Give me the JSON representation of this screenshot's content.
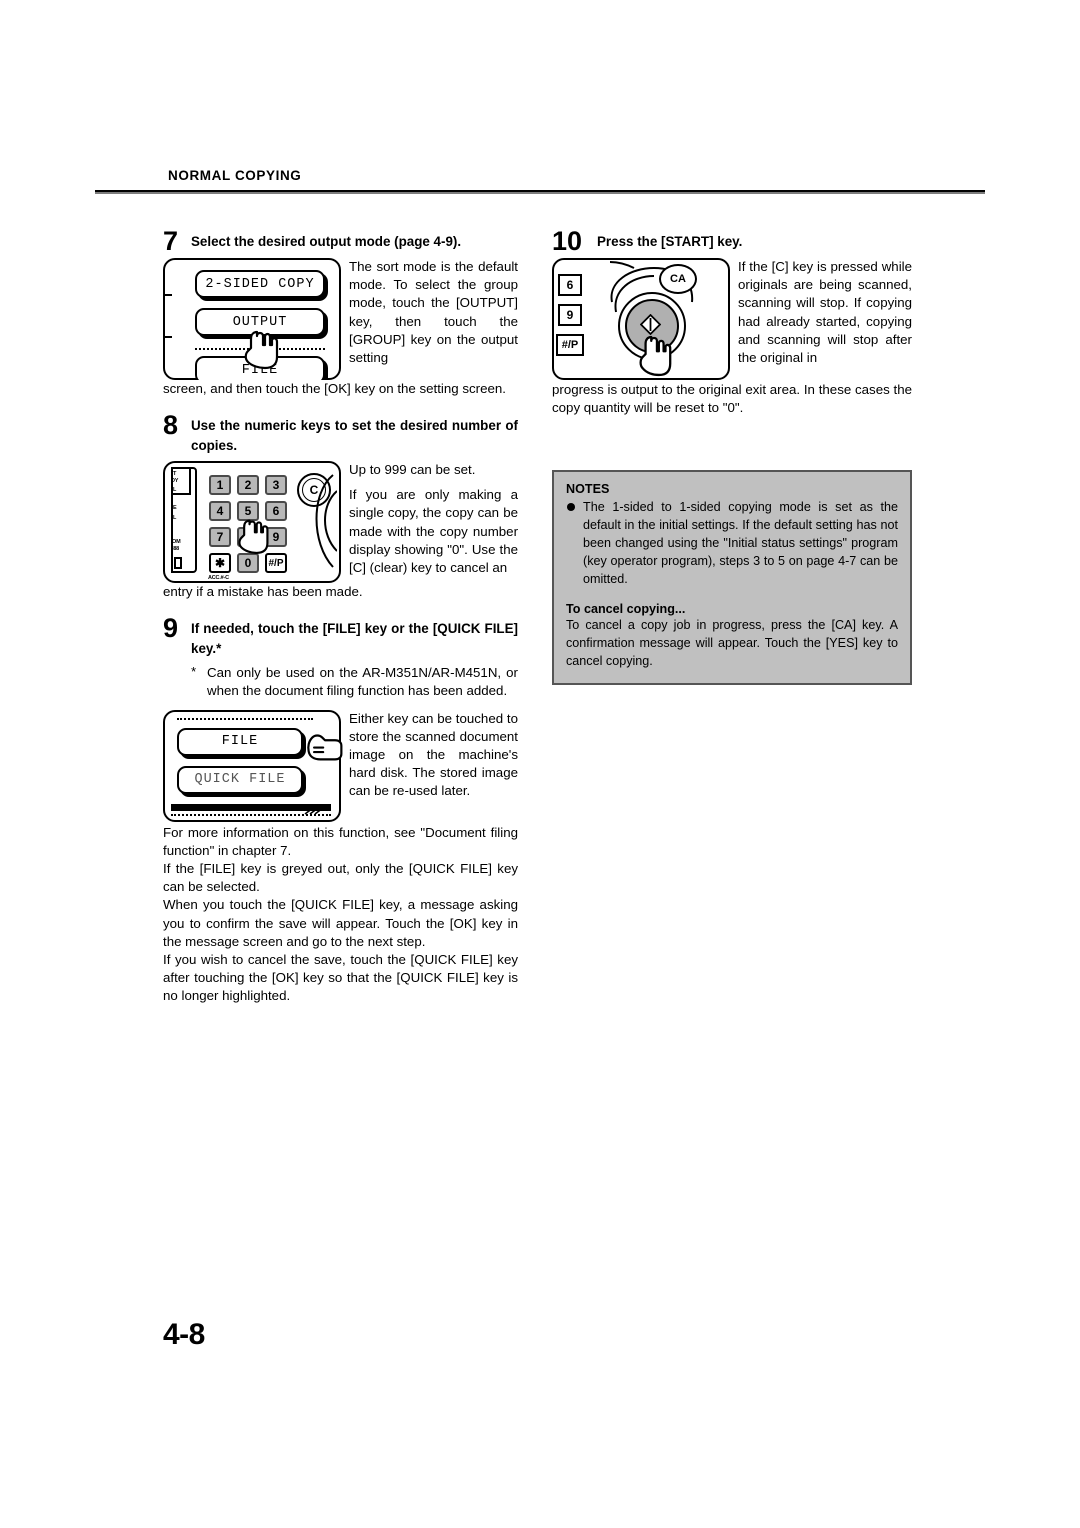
{
  "header": {
    "running_head": "NORMAL COPYING"
  },
  "page": {
    "number": "4-8"
  },
  "steps": {
    "step7": {
      "num": "7",
      "title": "Select the desired output mode (page 4-9).",
      "screen_keys": [
        "2-SIDED COPY",
        "OUTPUT",
        "FILE"
      ],
      "text_wrapped": "The sort mode is the default mode. To select the group mode, touch the [OUTPUT] key, then touch the [GROUP] key on the output setting",
      "text_full": "screen, and then touch the [OK] key on the setting screen."
    },
    "step8": {
      "num": "8",
      "title": "Use the numeric keys to set the desired number of copies.",
      "keypad": {
        "row1": [
          "1",
          "2",
          "3"
        ],
        "row2": [
          "4",
          "5",
          "6"
        ],
        "row3": [
          "7",
          "8",
          "9"
        ],
        "row4": [
          "✱",
          "0",
          "#/P"
        ],
        "clear_key": "C",
        "acc_label": "ACC.#-C"
      },
      "text_wrapped_1": "Up to 999 can be set.",
      "text_wrapped_2": "If you are only making a single copy, the copy can be made with the copy number display showing \"0\". Use the [C] (clear) key to cancel an",
      "text_full": "entry if a mistake has been made."
    },
    "step9": {
      "num": "9",
      "title": "If needed, touch the [FILE] key or the [QUICK FILE] key.*",
      "footnote_marker": "*",
      "footnote": "Can only be used on the AR-M351N/AR-M451N, or when the document filing function has been added.",
      "screen_keys": [
        "FILE",
        "QUICK FILE"
      ],
      "text_wrapped": "Either key can be touched to store the scanned document image on the machine's hard disk. The stored image can be re-used later.",
      "para_1": "For more information on this function, see \"Document filing function\" in chapter 7.",
      "para_2": "If the [FILE] key is greyed out, only the [QUICK FILE] key can be selected.",
      "para_3": "When you touch the [QUICK FILE] key, a message asking you to confirm the save will appear. Touch the [OK] key in the message screen and go to the next step.",
      "para_4": "If you wish to cancel the save, touch the [QUICK FILE] key after touching the [OK] key so that the [QUICK FILE] key is no longer highlighted."
    },
    "step10": {
      "num": "10",
      "title": "Press the [START] key.",
      "panel_keys": [
        "6",
        "9",
        "#/P"
      ],
      "ca_key": "CA",
      "text_wrapped": "If the [C] key is pressed while originals are being scanned, scanning will stop. If copying had already started, copying and scanning will stop after the original in",
      "text_full": "progress is output to the original exit area. In these cases the copy quantity will be reset to \"0\"."
    }
  },
  "notes": {
    "title": "NOTES",
    "item_1": "The 1-sided to 1-sided copying mode is set as the default in the initial settings. If the default setting has not been changed using the \"Initial status settings\" program (key operator program), steps 3 to 5 on page 4-7 can be omitted.",
    "subtitle": "To cancel copying...",
    "body": "To cancel a copy job in progress, press the [CA] key. A confirmation message will appear. Touch the [YES] key to cancel copying."
  },
  "colors": {
    "notes_background": "#c0c0c0",
    "notes_border": "#555555",
    "keypad_key": "#b8b8b8",
    "rule": "#000000"
  }
}
